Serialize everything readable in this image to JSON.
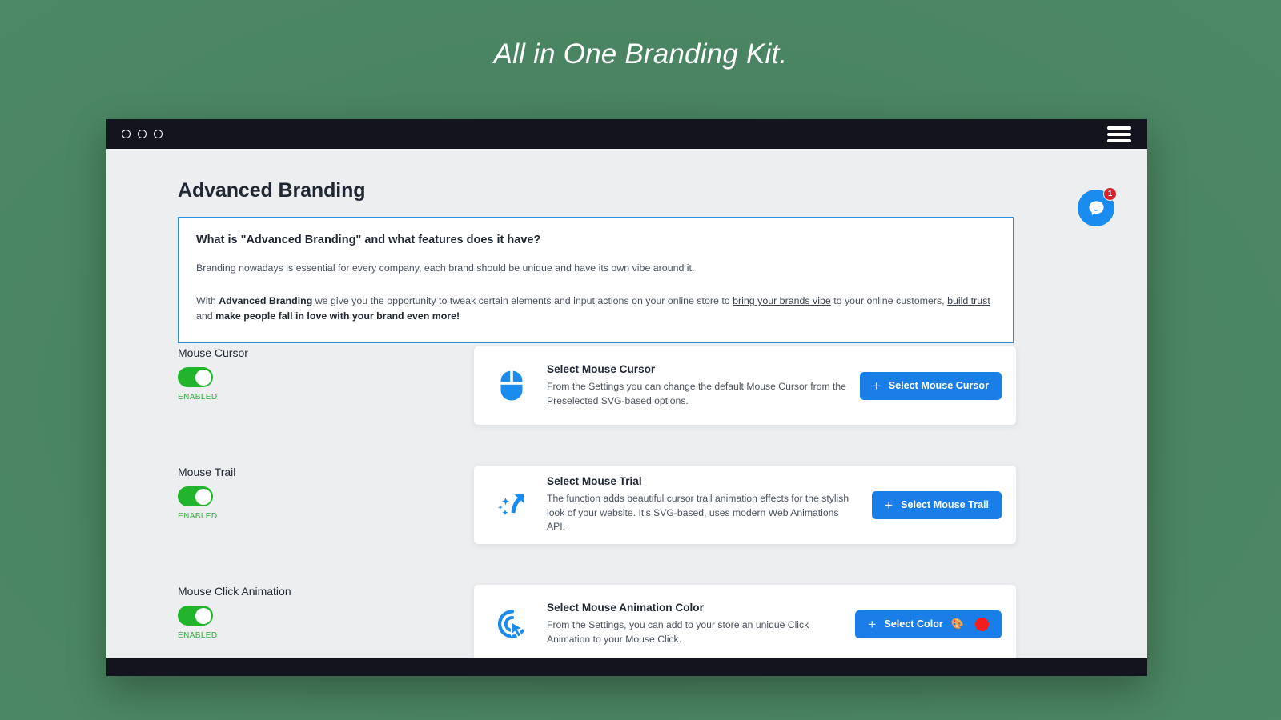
{
  "hero": {
    "title": "All in One Branding Kit."
  },
  "window": {
    "titlebar": {
      "dots_count": 3,
      "menu_icon": "hamburger-icon"
    }
  },
  "page": {
    "title": "Advanced Branding"
  },
  "chat": {
    "icon": "chat-bubble-icon",
    "badge_count": "1"
  },
  "info": {
    "heading": "What is \"Advanced Branding\" and what features does it have?",
    "paragraph1": "Branding nowadays is essential for every company, each brand should be unique and have its own vibe around it.",
    "paragraph2_part1": "With ",
    "paragraph2_bold1": "Advanced Branding",
    "paragraph2_part2": " we give you the opportunity to tweak certain elements and input actions on your online store to ",
    "paragraph2_link1": "bring your brands vibe",
    "paragraph2_part3": " to your online customers, ",
    "paragraph2_link2": "build trust",
    "paragraph2_part4": " and ",
    "paragraph2_bold2": "make people fall in love with your brand even more!"
  },
  "features": [
    {
      "label": "Mouse Cursor",
      "toggle_state": "on",
      "toggle_status": "ENABLED",
      "icon": "mouse-icon",
      "card_title": "Select Mouse Cursor",
      "card_desc": "From the Settings you can change the default Mouse Cursor from the Preselected SVG-based options.",
      "button_label": "Select Mouse Cursor",
      "button_plus": "+"
    },
    {
      "label": "Mouse Trail",
      "toggle_state": "on",
      "toggle_status": "ENABLED",
      "icon": "sparkle-trail-icon",
      "card_title": "Select Mouse Trial",
      "card_desc": "The function adds beautiful cursor trail animation effects for the stylish look of your website. It's SVG-based, uses modern Web Animations API.",
      "button_label": "Select Mouse Trail",
      "button_plus": "+"
    },
    {
      "label": "Mouse Click Animation",
      "toggle_state": "on",
      "toggle_status": "ENABLED",
      "icon": "click-ripple-cursor-icon",
      "card_title": "Select Mouse Animation Color",
      "card_desc": "From the Settings, you can add to your store an unique Click Animation to your Mouse Click.",
      "button_label": "Select Color",
      "button_plus": "+",
      "button_emoji": "🎨",
      "button_swatch_color": "#f41c1c"
    }
  ],
  "colors": {
    "background_green": "#48805f",
    "titlebar_dark": "#14141f",
    "accent_blue": "#1a7ee8",
    "toggle_green": "#22b42c",
    "info_border_blue": "#2d8fe0",
    "badge_red": "#d5212c"
  }
}
